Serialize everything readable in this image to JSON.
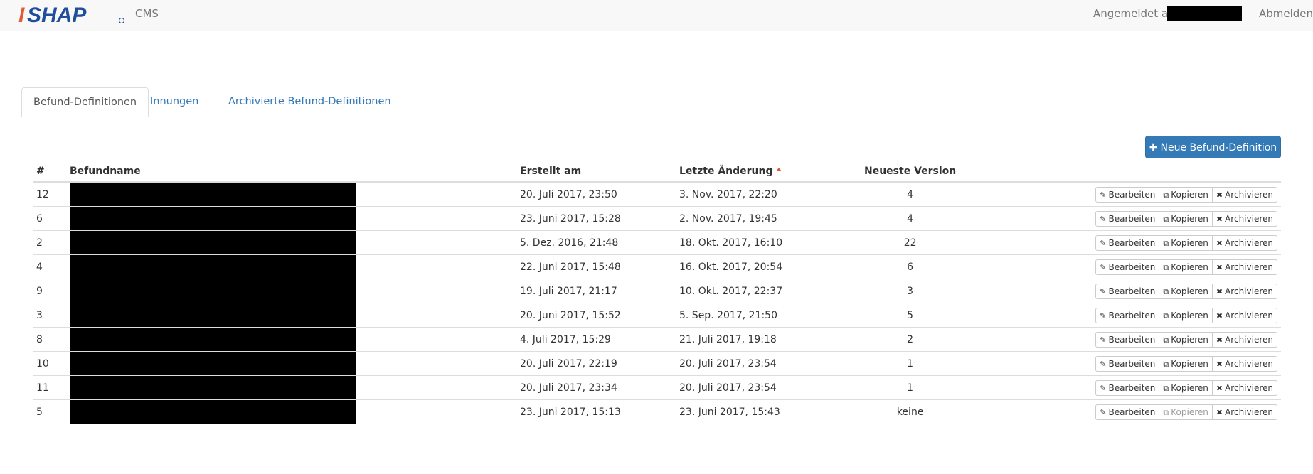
{
  "header": {
    "brand_logo_text": "ISHAP",
    "brand_label": "CMS",
    "logged_in_label": "Angemeldet als",
    "logout_label": "Abmelden"
  },
  "tabs": [
    {
      "label": "Befund-Definitionen",
      "active": true
    },
    {
      "label": "Innungen",
      "active": false
    },
    {
      "label": "Archivierte Befund-Definitionen",
      "active": false
    }
  ],
  "toolbar": {
    "new_button_label": "Neue Befund-Definition",
    "new_button_icon": "plus-icon"
  },
  "colors": {
    "primary": "#337ab7",
    "logo_orange": "#e35b32",
    "logo_blue": "#1f4f9c",
    "sort_caret": "#e35b32"
  },
  "table": {
    "columns": {
      "num": "#",
      "name": "Befundname",
      "created": "Erstellt am",
      "changed": "Letzte Änderung",
      "version": "Neueste Version"
    },
    "sorted_column": "changed",
    "actions": {
      "edit": "Bearbeiten",
      "copy": "Kopieren",
      "archive": "Archivieren"
    },
    "rows": [
      {
        "num": "12",
        "created": "20. Juli 2017, 23:50",
        "changed": "3. Nov. 2017, 22:20",
        "version": "4",
        "copy_enabled": true
      },
      {
        "num": "6",
        "created": "23. Juni 2017, 15:28",
        "changed": "2. Nov. 2017, 19:45",
        "version": "4",
        "copy_enabled": true
      },
      {
        "num": "2",
        "created": "5. Dez. 2016, 21:48",
        "changed": "18. Okt. 2017, 16:10",
        "version": "22",
        "copy_enabled": true
      },
      {
        "num": "4",
        "created": "22. Juni 2017, 15:48",
        "changed": "16. Okt. 2017, 20:54",
        "version": "6",
        "copy_enabled": true
      },
      {
        "num": "9",
        "created": "19. Juli 2017, 21:17",
        "changed": "10. Okt. 2017, 22:37",
        "version": "3",
        "copy_enabled": true
      },
      {
        "num": "3",
        "created": "20. Juni 2017, 15:52",
        "changed": "5. Sep. 2017, 21:50",
        "version": "5",
        "copy_enabled": true
      },
      {
        "num": "8",
        "created": "4. Juli 2017, 15:29",
        "changed": "21. Juli 2017, 19:18",
        "version": "2",
        "copy_enabled": true
      },
      {
        "num": "10",
        "created": "20. Juli 2017, 22:19",
        "changed": "20. Juli 2017, 23:54",
        "version": "1",
        "copy_enabled": true
      },
      {
        "num": "11",
        "created": "20. Juli 2017, 23:34",
        "changed": "20. Juli 2017, 23:54",
        "version": "1",
        "copy_enabled": true
      },
      {
        "num": "5",
        "created": "23. Juni 2017, 15:13",
        "changed": "23. Juni 2017, 15:43",
        "version": "keine",
        "copy_enabled": false
      }
    ]
  }
}
